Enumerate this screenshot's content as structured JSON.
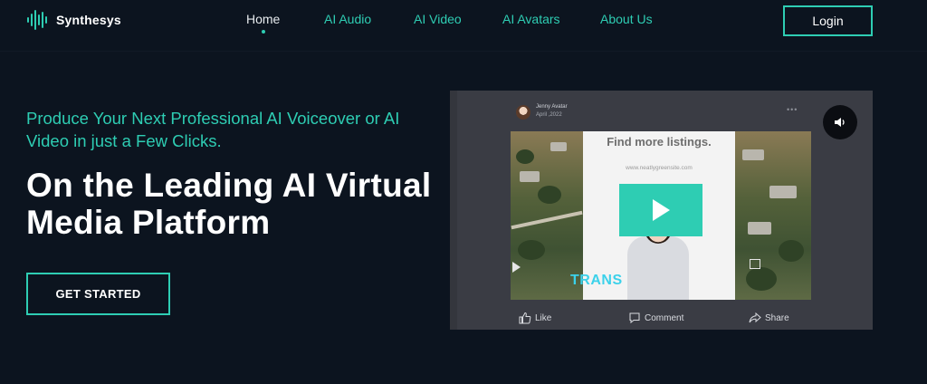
{
  "brand": {
    "name": "Synthesys",
    "accent": "#2ecdb3",
    "background": "#0c141f"
  },
  "nav": {
    "items": [
      {
        "label": "Home",
        "active": true
      },
      {
        "label": "AI Audio",
        "active": false
      },
      {
        "label": "AI Video",
        "active": false
      },
      {
        "label": "AI Avatars",
        "active": false
      },
      {
        "label": "About Us",
        "active": false
      }
    ],
    "login_label": "Login"
  },
  "hero": {
    "tagline": "Produce Your Next Professional AI Voiceover or AI Video in just a Few Clicks.",
    "headline": "On the Leading AI Virtual Media Platform",
    "cta_label": "GET STARTED"
  },
  "video": {
    "post_author": "Jenny Avatar",
    "post_date": "April ,2022",
    "more_icon": "ellipsis-icon",
    "sound_icon": "speaker-icon",
    "card_title": "Find more listings.",
    "card_url": "www.neatlygreensite.com",
    "overlay_text": "TRANS",
    "play_icon": "play-icon",
    "actions": {
      "like": "Like",
      "comment": "Comment",
      "share": "Share"
    }
  }
}
